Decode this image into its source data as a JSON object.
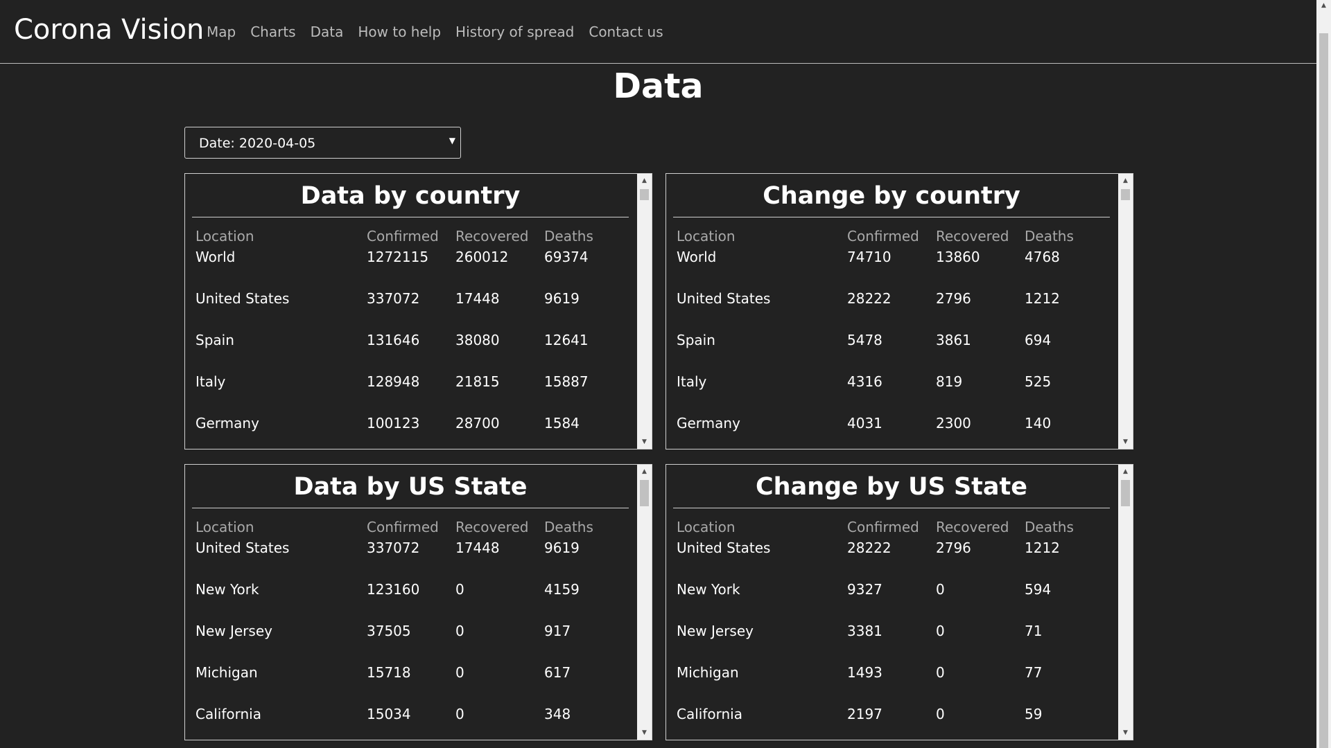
{
  "nav": {
    "brand": "Corona Vision",
    "links": [
      "Map",
      "Charts",
      "Data",
      "How to help",
      "History of spread",
      "Contact us"
    ]
  },
  "page": {
    "title": "Data",
    "date_select": "Date: 2020-04-05"
  },
  "columns": [
    "Location",
    "Confirmed",
    "Recovered",
    "Deaths"
  ],
  "panels": [
    {
      "title": "Data by country",
      "rows": [
        [
          "World",
          "1272115",
          "260012",
          "69374"
        ],
        [
          "United States",
          "337072",
          "17448",
          "9619"
        ],
        [
          "Spain",
          "131646",
          "38080",
          "12641"
        ],
        [
          "Italy",
          "128948",
          "21815",
          "15887"
        ],
        [
          "Germany",
          "100123",
          "28700",
          "1584"
        ]
      ]
    },
    {
      "title": "Change by country",
      "rows": [
        [
          "World",
          "74710",
          "13860",
          "4768"
        ],
        [
          "United States",
          "28222",
          "2796",
          "1212"
        ],
        [
          "Spain",
          "5478",
          "3861",
          "694"
        ],
        [
          "Italy",
          "4316",
          "819",
          "525"
        ],
        [
          "Germany",
          "4031",
          "2300",
          "140"
        ]
      ]
    },
    {
      "title": "Data by US State",
      "rows": [
        [
          "United States",
          "337072",
          "17448",
          "9619"
        ],
        [
          "New York",
          "123160",
          "0",
          "4159"
        ],
        [
          "New Jersey",
          "37505",
          "0",
          "917"
        ],
        [
          "Michigan",
          "15718",
          "0",
          "617"
        ],
        [
          "California",
          "15034",
          "0",
          "348"
        ]
      ]
    },
    {
      "title": "Change by US State",
      "rows": [
        [
          "United States",
          "28222",
          "2796",
          "1212"
        ],
        [
          "New York",
          "9327",
          "0",
          "594"
        ],
        [
          "New Jersey",
          "3381",
          "0",
          "71"
        ],
        [
          "Michigan",
          "1493",
          "0",
          "77"
        ],
        [
          "California",
          "2197",
          "0",
          "59"
        ]
      ]
    }
  ]
}
